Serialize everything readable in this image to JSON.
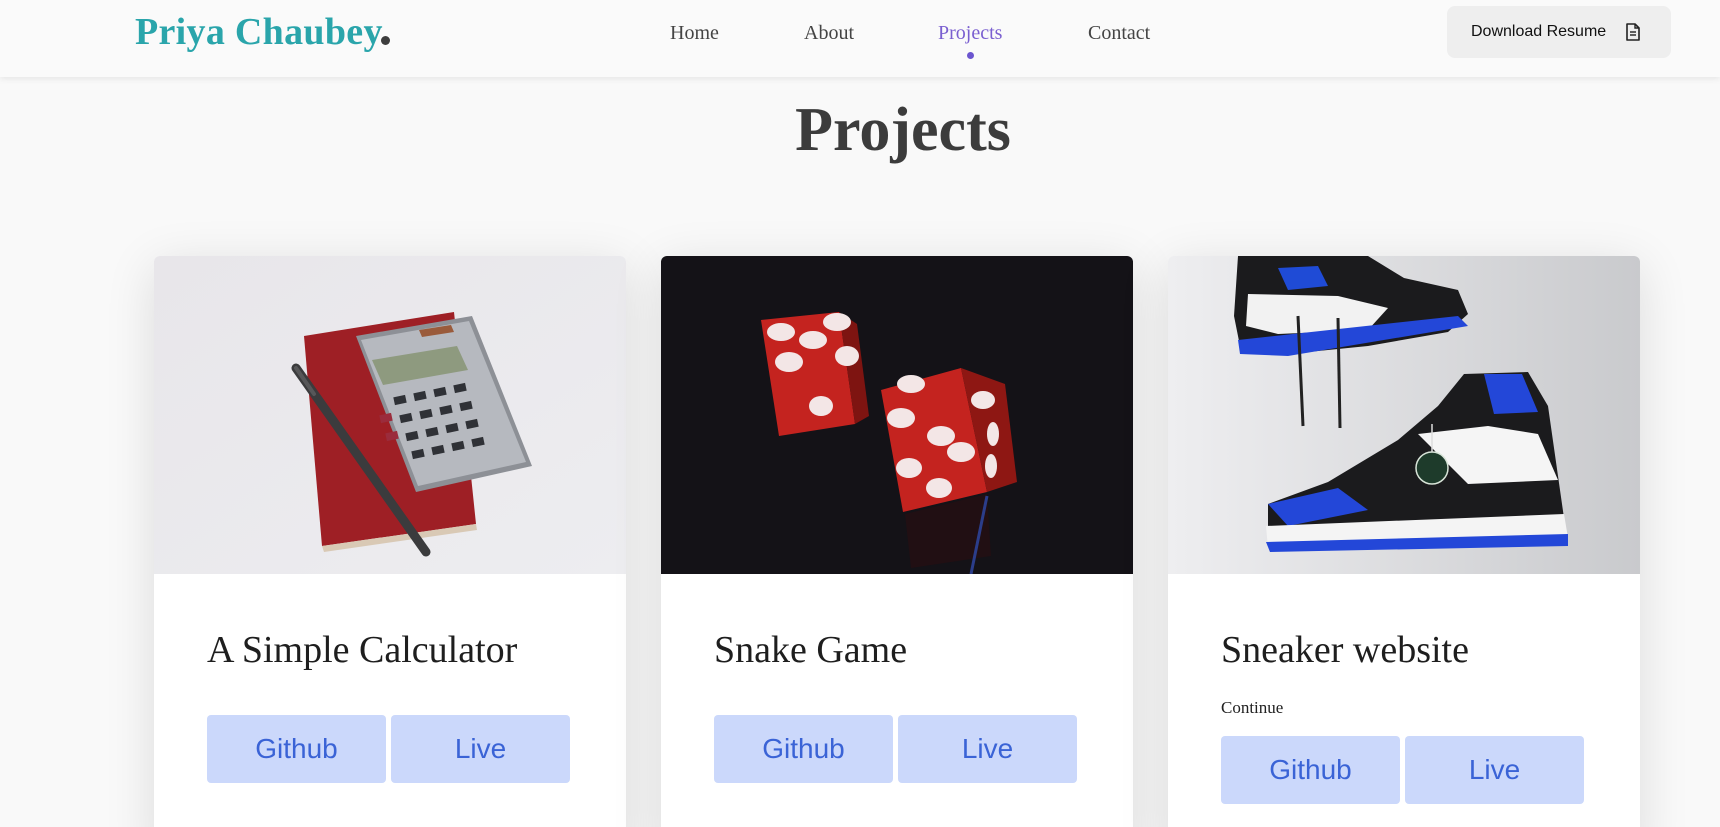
{
  "brand": {
    "name": "Priya Chaubey"
  },
  "nav": {
    "items": [
      {
        "label": "Home",
        "active": false
      },
      {
        "label": "About",
        "active": false
      },
      {
        "label": "Projects",
        "active": true
      },
      {
        "label": "Contact",
        "active": false
      }
    ],
    "resume_label": "Download Resume",
    "resume_icon": "file-document-icon"
  },
  "section": {
    "title": "Projects"
  },
  "projects": [
    {
      "title": "A Simple Calculator",
      "description": "",
      "github_label": "Github",
      "live_label": "Live",
      "image": "calculator-notebook-pen-photo"
    },
    {
      "title": "Snake Game",
      "description": "",
      "github_label": "Github",
      "live_label": "Live",
      "image": "red-dice-photo"
    },
    {
      "title": "Sneaker website",
      "description": "Continue",
      "github_label": "Github",
      "live_label": "Live",
      "image": "sneakers-photo"
    }
  ],
  "colors": {
    "brand": "#2aa5ab",
    "nav_active": "#7a5fd0",
    "button_bg": "#cbd8fb",
    "button_text": "#3a63d6"
  }
}
